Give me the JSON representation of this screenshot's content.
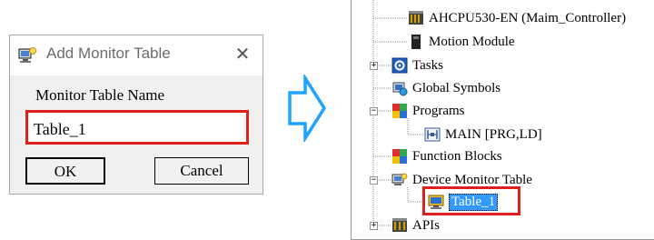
{
  "dialog": {
    "title": "Add Monitor Table",
    "close_glyph": "✕",
    "field_label": "Monitor Table Name",
    "input_value": "Table_1",
    "ok_label": "OK",
    "cancel_label": "Cancel",
    "icon": "monitor-table-icon"
  },
  "arrow": {
    "icon": "right-arrow-icon",
    "color": "#1fa3ff"
  },
  "tree": {
    "items": [
      {
        "label": "AHCPU530-EN  (Maim_Controller)",
        "icon": "plc-controller-icon"
      },
      {
        "label": "Motion Module",
        "icon": "motion-module-icon"
      },
      {
        "label": "Tasks",
        "icon": "tasks-icon",
        "expander": "+"
      },
      {
        "label": "Global Symbols",
        "icon": "global-symbols-icon"
      },
      {
        "label": "Programs",
        "icon": "programs-icon",
        "expander": "−"
      },
      {
        "label": "MAIN [PRG,LD]",
        "icon": "program-ld-icon"
      },
      {
        "label": "Function Blocks",
        "icon": "function-blocks-icon"
      },
      {
        "label": "Device Monitor Table",
        "icon": "device-monitor-table-icon",
        "expander": "−"
      },
      {
        "label": "Table_1",
        "icon": "monitor-table-icon",
        "selected": true
      },
      {
        "label": "APIs",
        "icon": "apis-icon",
        "expander": "+"
      }
    ]
  },
  "colors": {
    "highlight": "#e0201c",
    "selection": "#3399ff"
  }
}
